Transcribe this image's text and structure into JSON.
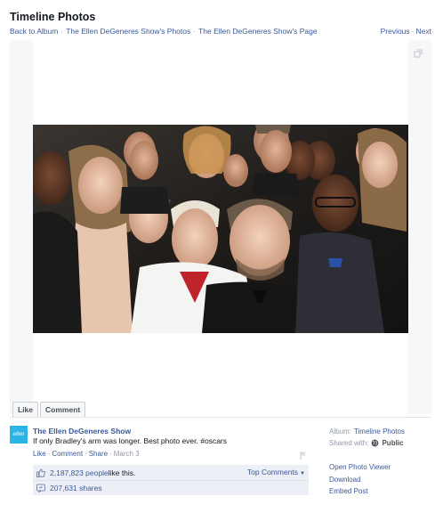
{
  "header": {
    "title": "Timeline Photos",
    "breadcrumb": [
      "Back to Album",
      "The Ellen DeGeneres Show's Photos",
      "The Ellen DeGeneres Show's Page"
    ],
    "previous_label": "Previous",
    "next_label": "Next"
  },
  "photo": {
    "icons": {
      "expand": "expand-icon"
    }
  },
  "actions": {
    "like_label": "Like",
    "comment_label": "Comment"
  },
  "post": {
    "avatar_text": "ellen",
    "author": "The Ellen DeGeneres Show",
    "caption": "If only Bradley's arm was longer. Best photo ever. #oscars",
    "like_link": "Like",
    "comment_link": "Comment",
    "share_link": "Share",
    "date": "March 3"
  },
  "ufi": {
    "likes_count": "2,187,823 people",
    "likes_suffix": " like this.",
    "top_comments_label": "Top Comments",
    "shares_label": "207,631 shares"
  },
  "sidebar": {
    "album_label": "Album:",
    "album_value": "Timeline Photos",
    "shared_label": "Shared with:",
    "shared_value": "Public",
    "links": [
      "Open Photo Viewer",
      "Download",
      "Embed Post"
    ]
  },
  "colors": {
    "link": "#3b5998",
    "ufi_bg": "#eceff5",
    "avatar_bg": "#2db4e6"
  }
}
